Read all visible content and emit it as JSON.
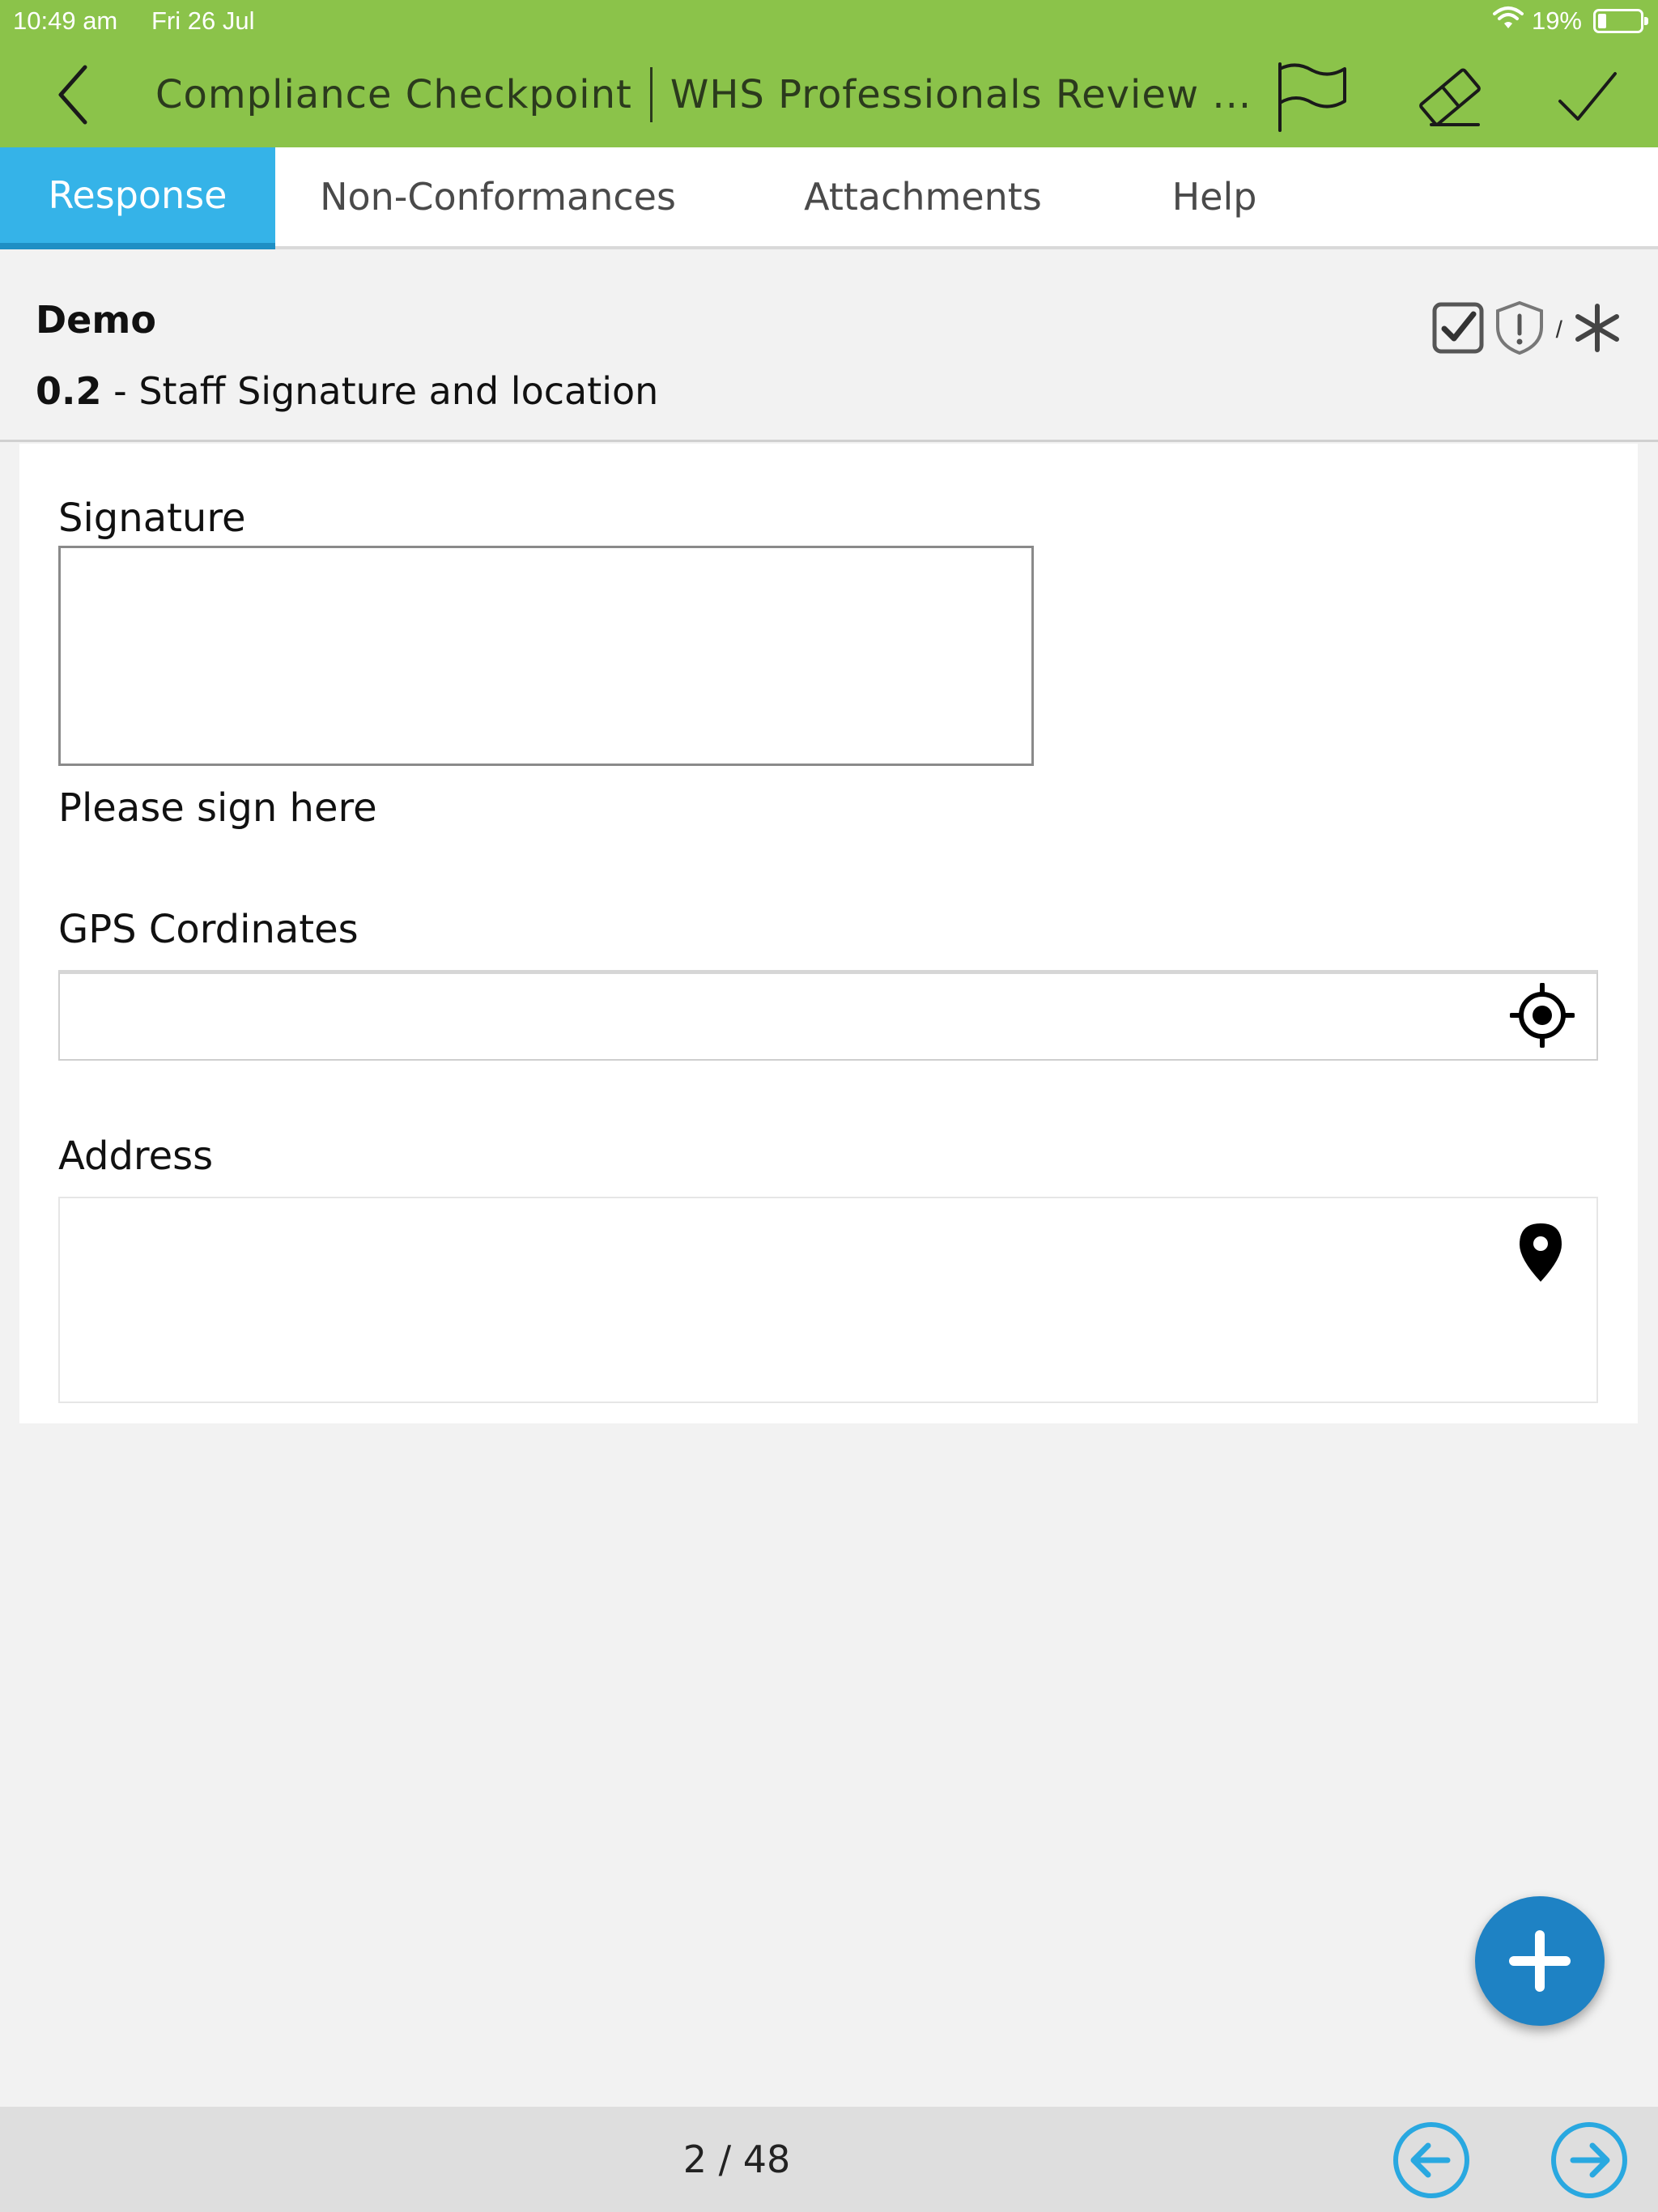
{
  "status_bar": {
    "time": "10:49 am",
    "date": "Fri 26 Jul",
    "battery": "19%",
    "wifi_icon": "wifi-icon",
    "battery_icon": "battery-icon"
  },
  "header": {
    "title": "Compliance Checkpoint",
    "subtitle": "WHS Professionals Review ...",
    "back_icon": "chevron-left-icon",
    "flag_icon": "flag-icon",
    "eraser_icon": "eraser-icon",
    "check_icon": "checkmark-icon",
    "background": "#8bc34a"
  },
  "tabs": [
    {
      "label": "Response",
      "active": true
    },
    {
      "label": "Non-Conformances",
      "active": false
    },
    {
      "label": "Attachments",
      "active": false
    },
    {
      "label": "Help",
      "active": false
    }
  ],
  "question": {
    "section": "Demo",
    "number": "0.2",
    "separator": " - ",
    "title": "Staff Signature and location",
    "indicator_separator": "/",
    "icons": [
      "checkbox-checked-icon",
      "shield-alert-icon",
      "asterisk-icon"
    ]
  },
  "form": {
    "signature": {
      "label": "Signature",
      "hint": "Please sign here"
    },
    "gps": {
      "label": "GPS Cordinates",
      "value": "",
      "icon": "locate-icon"
    },
    "address": {
      "label": "Address",
      "value": "",
      "icon": "map-pin-icon"
    }
  },
  "fab": {
    "icon": "plus-icon",
    "color": "#1e82c4"
  },
  "footer": {
    "page_indicator": "2 / 48",
    "prev_icon": "arrow-left-circle-icon",
    "next_icon": "arrow-right-circle-icon",
    "accent": "#29a8e0"
  }
}
